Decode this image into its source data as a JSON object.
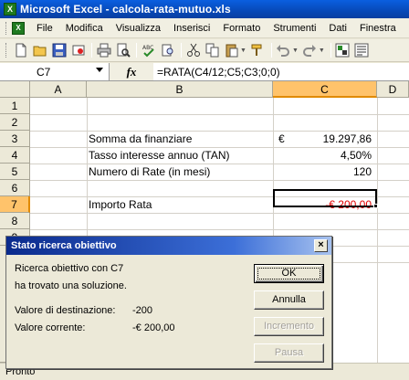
{
  "window": {
    "title": "Microsoft Excel - calcola-rata-mutuo.xls"
  },
  "menu": [
    "File",
    "Modifica",
    "Visualizza",
    "Inserisci",
    "Formato",
    "Strumenti",
    "Dati",
    "Finestra"
  ],
  "formula_bar": {
    "name_box": "C7",
    "fx": "fx",
    "formula": "=RATA(C4/12;C5;C3;0;0)"
  },
  "columns": [
    "A",
    "B",
    "C",
    "D"
  ],
  "rows": [
    "1",
    "2",
    "3",
    "4",
    "5",
    "6",
    "7",
    "8",
    "9"
  ],
  "cells": {
    "b3": "Somma da finanziare",
    "c3_currency": "€",
    "c3": "19.297,86",
    "b4": "Tasso interesse annuo (TAN)",
    "c4": "4,50%",
    "b5": "Numero di Rate (in mesi)",
    "c5": "120",
    "b7": "Importo Rata",
    "c7": "-€ 200,00"
  },
  "dialog": {
    "title": "Stato ricerca obiettivo",
    "line1": "Ricerca obiettivo con C7",
    "line2": "ha trovato una soluzione.",
    "target_label": "Valore di destinazione:",
    "target_value": "-200",
    "current_label": "Valore corrente:",
    "current_value": "-€ 200,00",
    "buttons": {
      "ok": "OK",
      "cancel": "Annulla",
      "step": "Incremento",
      "pause": "Pausa"
    },
    "close": "×"
  },
  "status": "Pronto",
  "colors": {
    "title_blue": "#0a5fe0",
    "negative_red": "#e00000",
    "selection_orange": "#ffc36b"
  }
}
